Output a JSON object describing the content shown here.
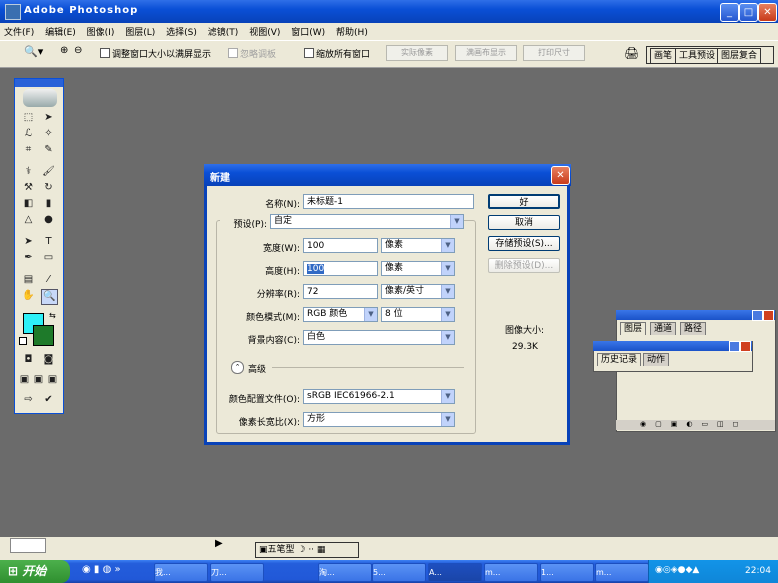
{
  "window": {
    "title": "Adobe Photoshop"
  },
  "menu": [
    "文件(F)",
    "编辑(E)",
    "图像(I)",
    "图层(L)",
    "选择(S)",
    "滤镜(T)",
    "视图(V)",
    "窗口(W)",
    "帮助(H)"
  ],
  "options": {
    "resize_windows": "调整窗口大小以满屏显示",
    "ignore_palettes": "忽略调板",
    "zoom_all": "缩放所有窗口",
    "actual_pixels": "实际像素",
    "fit_screen": "满画布显示",
    "print_size": "打印尺寸",
    "dock_tabs": [
      "画笔",
      "工具预设",
      "图层复合"
    ]
  },
  "dialog": {
    "title": "新建",
    "name_label": "名称(N):",
    "name_value": "未标题-1",
    "preset_label": "预设(P):",
    "preset_value": "自定",
    "width_label": "宽度(W):",
    "width_value": "100",
    "width_unit": "像素",
    "height_label": "高度(H):",
    "height_value": "100",
    "height_unit": "像素",
    "resolution_label": "分辨率(R):",
    "resolution_value": "72",
    "resolution_unit": "像素/英寸",
    "mode_label": "颜色模式(M):",
    "mode_value": "RGB 颜色",
    "depth_value": "8 位",
    "bg_label": "背景内容(C):",
    "bg_value": "白色",
    "advanced_label": "高级",
    "profile_label": "颜色配置文件(O):",
    "profile_value": "sRGB IEC61966-2.1",
    "aspect_label": "像素长宽比(X):",
    "aspect_value": "方形",
    "ok": "好",
    "cancel": "取消",
    "save_preset": "存储预设(S)...",
    "delete_preset": "删除预设(D)...",
    "image_size_label": "图像大小:",
    "image_size_value": "29.3K"
  },
  "panels": {
    "layers_tabs": [
      "图层",
      "通道",
      "路径"
    ],
    "history_tabs": [
      "历史记录",
      "动作"
    ]
  },
  "ime": {
    "label": "五笔型"
  },
  "taskbar": {
    "start": "开始",
    "tasks": [
      "我...",
      "刀...",
      "淘...",
      "5...",
      "A...",
      "m...",
      "1...",
      "m..."
    ],
    "clock": "22:04"
  },
  "colors": {
    "foreground": "#2ef0f7",
    "background": "#1e7a2a"
  }
}
